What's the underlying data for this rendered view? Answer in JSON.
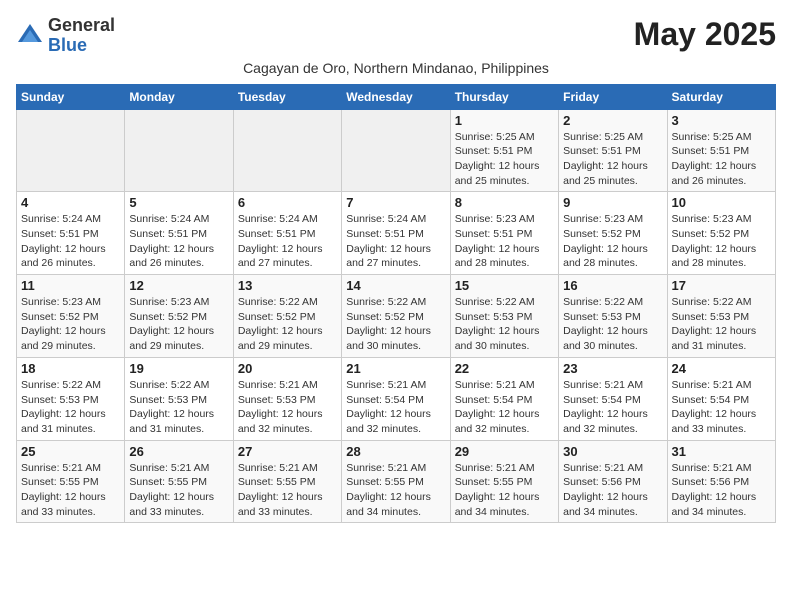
{
  "logo": {
    "general": "General",
    "blue": "Blue"
  },
  "title": "May 2025",
  "subtitle": "Cagayan de Oro, Northern Mindanao, Philippines",
  "days_header": [
    "Sunday",
    "Monday",
    "Tuesday",
    "Wednesday",
    "Thursday",
    "Friday",
    "Saturday"
  ],
  "weeks": [
    [
      {
        "day": "",
        "info": ""
      },
      {
        "day": "",
        "info": ""
      },
      {
        "day": "",
        "info": ""
      },
      {
        "day": "",
        "info": ""
      },
      {
        "day": "1",
        "info": "Sunrise: 5:25 AM\nSunset: 5:51 PM\nDaylight: 12 hours\nand 25 minutes."
      },
      {
        "day": "2",
        "info": "Sunrise: 5:25 AM\nSunset: 5:51 PM\nDaylight: 12 hours\nand 25 minutes."
      },
      {
        "day": "3",
        "info": "Sunrise: 5:25 AM\nSunset: 5:51 PM\nDaylight: 12 hours\nand 26 minutes."
      }
    ],
    [
      {
        "day": "4",
        "info": "Sunrise: 5:24 AM\nSunset: 5:51 PM\nDaylight: 12 hours\nand 26 minutes."
      },
      {
        "day": "5",
        "info": "Sunrise: 5:24 AM\nSunset: 5:51 PM\nDaylight: 12 hours\nand 26 minutes."
      },
      {
        "day": "6",
        "info": "Sunrise: 5:24 AM\nSunset: 5:51 PM\nDaylight: 12 hours\nand 27 minutes."
      },
      {
        "day": "7",
        "info": "Sunrise: 5:24 AM\nSunset: 5:51 PM\nDaylight: 12 hours\nand 27 minutes."
      },
      {
        "day": "8",
        "info": "Sunrise: 5:23 AM\nSunset: 5:51 PM\nDaylight: 12 hours\nand 28 minutes."
      },
      {
        "day": "9",
        "info": "Sunrise: 5:23 AM\nSunset: 5:52 PM\nDaylight: 12 hours\nand 28 minutes."
      },
      {
        "day": "10",
        "info": "Sunrise: 5:23 AM\nSunset: 5:52 PM\nDaylight: 12 hours\nand 28 minutes."
      }
    ],
    [
      {
        "day": "11",
        "info": "Sunrise: 5:23 AM\nSunset: 5:52 PM\nDaylight: 12 hours\nand 29 minutes."
      },
      {
        "day": "12",
        "info": "Sunrise: 5:23 AM\nSunset: 5:52 PM\nDaylight: 12 hours\nand 29 minutes."
      },
      {
        "day": "13",
        "info": "Sunrise: 5:22 AM\nSunset: 5:52 PM\nDaylight: 12 hours\nand 29 minutes."
      },
      {
        "day": "14",
        "info": "Sunrise: 5:22 AM\nSunset: 5:52 PM\nDaylight: 12 hours\nand 30 minutes."
      },
      {
        "day": "15",
        "info": "Sunrise: 5:22 AM\nSunset: 5:53 PM\nDaylight: 12 hours\nand 30 minutes."
      },
      {
        "day": "16",
        "info": "Sunrise: 5:22 AM\nSunset: 5:53 PM\nDaylight: 12 hours\nand 30 minutes."
      },
      {
        "day": "17",
        "info": "Sunrise: 5:22 AM\nSunset: 5:53 PM\nDaylight: 12 hours\nand 31 minutes."
      }
    ],
    [
      {
        "day": "18",
        "info": "Sunrise: 5:22 AM\nSunset: 5:53 PM\nDaylight: 12 hours\nand 31 minutes."
      },
      {
        "day": "19",
        "info": "Sunrise: 5:22 AM\nSunset: 5:53 PM\nDaylight: 12 hours\nand 31 minutes."
      },
      {
        "day": "20",
        "info": "Sunrise: 5:21 AM\nSunset: 5:53 PM\nDaylight: 12 hours\nand 32 minutes."
      },
      {
        "day": "21",
        "info": "Sunrise: 5:21 AM\nSunset: 5:54 PM\nDaylight: 12 hours\nand 32 minutes."
      },
      {
        "day": "22",
        "info": "Sunrise: 5:21 AM\nSunset: 5:54 PM\nDaylight: 12 hours\nand 32 minutes."
      },
      {
        "day": "23",
        "info": "Sunrise: 5:21 AM\nSunset: 5:54 PM\nDaylight: 12 hours\nand 32 minutes."
      },
      {
        "day": "24",
        "info": "Sunrise: 5:21 AM\nSunset: 5:54 PM\nDaylight: 12 hours\nand 33 minutes."
      }
    ],
    [
      {
        "day": "25",
        "info": "Sunrise: 5:21 AM\nSunset: 5:55 PM\nDaylight: 12 hours\nand 33 minutes."
      },
      {
        "day": "26",
        "info": "Sunrise: 5:21 AM\nSunset: 5:55 PM\nDaylight: 12 hours\nand 33 minutes."
      },
      {
        "day": "27",
        "info": "Sunrise: 5:21 AM\nSunset: 5:55 PM\nDaylight: 12 hours\nand 33 minutes."
      },
      {
        "day": "28",
        "info": "Sunrise: 5:21 AM\nSunset: 5:55 PM\nDaylight: 12 hours\nand 34 minutes."
      },
      {
        "day": "29",
        "info": "Sunrise: 5:21 AM\nSunset: 5:55 PM\nDaylight: 12 hours\nand 34 minutes."
      },
      {
        "day": "30",
        "info": "Sunrise: 5:21 AM\nSunset: 5:56 PM\nDaylight: 12 hours\nand 34 minutes."
      },
      {
        "day": "31",
        "info": "Sunrise: 5:21 AM\nSunset: 5:56 PM\nDaylight: 12 hours\nand 34 minutes."
      }
    ]
  ]
}
